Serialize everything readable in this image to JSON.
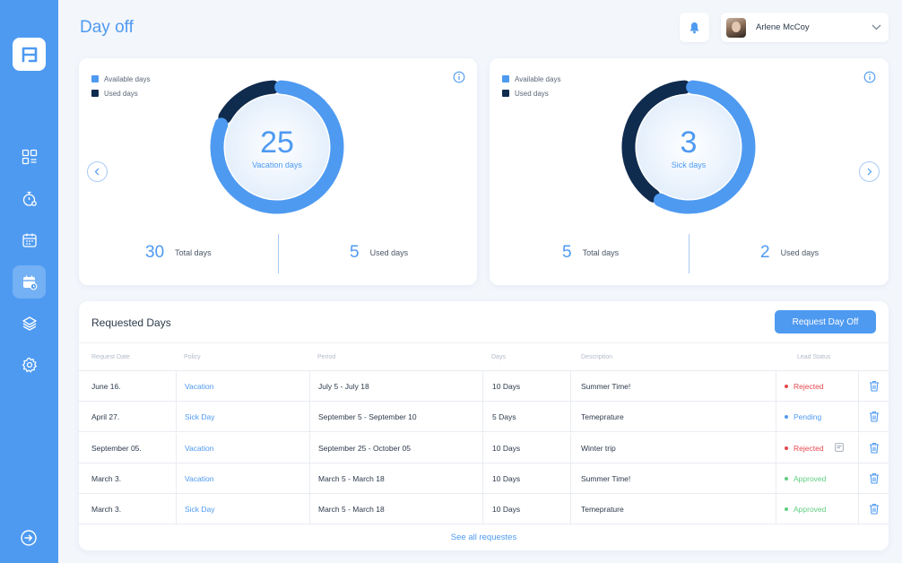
{
  "header": {
    "title": "Day off",
    "user_name": "Arlene McCoy"
  },
  "legend": {
    "available": "Available days",
    "used": "Used days"
  },
  "colors": {
    "accent": "#4e9af1",
    "dark": "#0f2b4e",
    "rejected": "#e5484d",
    "pending": "#4e9af1",
    "approved": "#5fcf80"
  },
  "vacation": {
    "value": "25",
    "label": "Vacation days",
    "total_num": "30",
    "total_label": "Total days",
    "used_num": "5",
    "used_label": "Used days",
    "used_fraction": 0.1667
  },
  "sick": {
    "value": "3",
    "label": "Sick days",
    "total_num": "5",
    "total_label": "Total days",
    "used_num": "2",
    "used_label": "Used days",
    "used_fraction": 0.4
  },
  "requests": {
    "title": "Requested Days",
    "button": "Request Day Off",
    "see_all": "See all requestes",
    "columns": [
      "Request Date",
      "Policy",
      "Period",
      "Days",
      "Description",
      "Lead Status"
    ],
    "rows": [
      {
        "date": "June 16.",
        "policy": "Vacation",
        "period": "July 5 - July 18",
        "days": "10 Days",
        "desc": "Summer Time!",
        "status": "Rejected",
        "kind": "rejected",
        "note": false
      },
      {
        "date": "April 27.",
        "policy": "Sick Day",
        "period": "September 5 - September 10",
        "days": "5 Days",
        "desc": "Temeprature",
        "status": "Pending",
        "kind": "pending",
        "note": false
      },
      {
        "date": "September 05.",
        "policy": "Vacation",
        "period": "September 25 - October 05",
        "days": "10 Days",
        "desc": "Winter trip",
        "status": "Rejected",
        "kind": "rejected",
        "note": true
      },
      {
        "date": "March 3.",
        "policy": "Vacation",
        "period": "March 5 - March 18",
        "days": "10 Days",
        "desc": "Summer Time!",
        "status": "Approved",
        "kind": "approved",
        "note": false
      },
      {
        "date": "March 3.",
        "policy": "Sick Day",
        "period": "March 5 - March 18",
        "days": "10 Days",
        "desc": "Temepraturе",
        "status": "Approved",
        "kind": "approved",
        "note": false
      }
    ]
  }
}
